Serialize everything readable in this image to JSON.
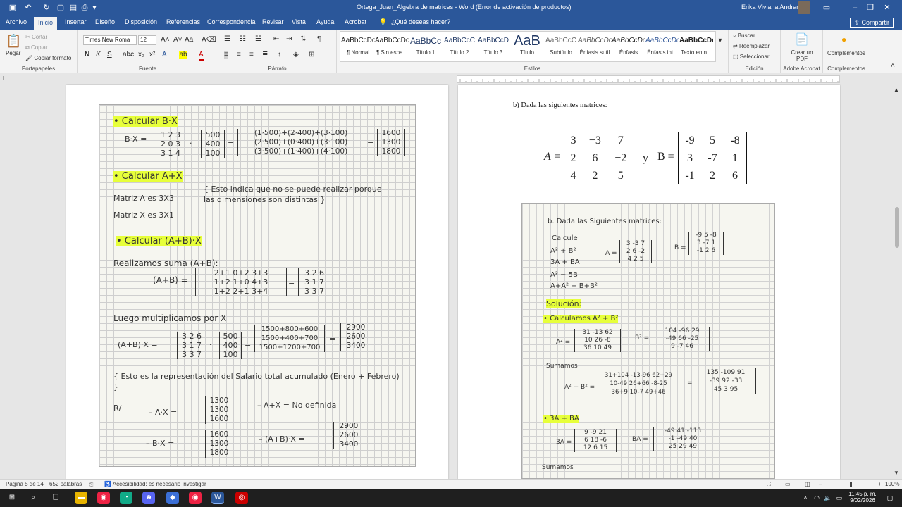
{
  "titlebar": {
    "document_title": "Ortega_Juan_Algebra de matrices  -  Word (Error de activación de productos)",
    "user": "Erika Viviana Andrade"
  },
  "menu": {
    "tabs": [
      "Archivo",
      "Inicio",
      "Insertar",
      "Diseño",
      "Disposición",
      "Referencias",
      "Correspondencia",
      "Revisar",
      "Vista",
      "Ayuda",
      "Acrobat"
    ],
    "search": "¿Qué deseas hacer?",
    "share": "Compartir"
  },
  "ribbon": {
    "clipboard": {
      "paste": "Pegar",
      "cut": "Cortar",
      "copy": "Copiar",
      "format_painter": "Copiar formato",
      "label": "Portapapeles"
    },
    "font": {
      "family": "Times New Roma",
      "size": "12",
      "label": "Fuente",
      "bold": "N",
      "italic": "K",
      "underline": "S"
    },
    "paragraph": {
      "label": "Párrafo"
    },
    "styles": {
      "label": "Estilos",
      "items": [
        {
          "preview": "AaBbCcDc",
          "name": "¶ Normal"
        },
        {
          "preview": "AaBbCcDc",
          "name": "¶ Sin espa..."
        },
        {
          "preview": "AaBbCc",
          "name": "Título 1"
        },
        {
          "preview": "AaBbCcC",
          "name": "Título 2"
        },
        {
          "preview": "AaBbCcD",
          "name": "Título 3"
        },
        {
          "preview": "AaB",
          "name": "Título"
        },
        {
          "preview": "AaBbCcC",
          "name": "Subtítulo"
        },
        {
          "preview": "AaBbCcDc",
          "name": "Énfasis sutil"
        },
        {
          "preview": "AaBbCcDc",
          "name": "Énfasis"
        },
        {
          "preview": "AaBbCcDc",
          "name": "Énfasis int..."
        },
        {
          "preview": "AaBbCcDc",
          "name": "Texto en n..."
        }
      ]
    },
    "editing": {
      "find": "Buscar",
      "replace": "Reemplazar",
      "select": "Seleccionar",
      "label": "Edición"
    },
    "adobe": {
      "create_pdf": "Crear un PDF",
      "label": "Adobe Acrobat"
    },
    "addins": {
      "button": "Complementos",
      "label": "Complementos"
    }
  },
  "document": {
    "heading": "b)   Dada las siguientes matrices:",
    "matrix_A": [
      [
        "3",
        "−3",
        "7"
      ],
      [
        "2",
        "6",
        "−2"
      ],
      [
        "4",
        "2",
        "5"
      ]
    ],
    "matrix_B": [
      [
        "-9",
        "5",
        "-8"
      ],
      [
        "3",
        "-7",
        "1"
      ],
      [
        "-1",
        "2",
        "6"
      ]
    ],
    "A_label": "A =",
    "conj": "y",
    "B_label": "B =",
    "notes1": [
      "• Calcular B·X",
      "B·X = [1 2 3 / 2 0 3 / 3 1 4] · [500 / 400 / 100] = [(1·500)+(2·400)+(3·100) / (2·500)+(0·400)+(3·100) / (3·500)+(1·400)+(4·100)] = [1600 / 1300 / 1800]",
      "• Calcular A+X",
      "Matriz A es 3X3",
      "{ Esto indica que no se puede realizar porque las dimensiones son distintas }",
      "Matriz X es 3X1",
      "• Calcular (A+B)·X",
      "Realizamos suma (A+B):",
      "(A+B) = [2+1 0+2 3+3 / 1+2 1+0 4+3 / 1+2 2+1 3+4] = [3 2 6 / 3 1 7 / 3 3 7]",
      "Luego multiplicamos por X",
      "(A+B)·X = [3 2 6 / 3 1 7 / 3 3 7] · [500 / 400 / 100] = [1500+800+600 / 1500+400+700 / 1500+1200+700] = [2900 / 2600 / 3400]",
      "{ Esto es la representación del Salario total acumulado (Enero + Febrero) }",
      "R/ –  A·X = [1300 / 1300 / 1600]   – A+X = No definida",
      "– B·X = [1600 / 1300 / 1800]   – (A+B)·X = [2900 / 2600 / 3400]"
    ],
    "notes2": [
      "b. Dada las Siguientes matrices:",
      "Calcule",
      "A² + B²",
      "3A + BA",
      "A² − 5B",
      "A+A² + B+B²",
      "Solución:",
      "• Calculamos A² + B²",
      "A² = [31 -13 62 / 10 26 -8 / 36 10 49]   B² = [104 -96 29 / -49 66 -25 / 9 -7 46]",
      "Sumamos",
      "A² + B² = [31+104 -13-96 62+29 / 10-49 26+66 -8-25 / 36+9 10-7 49+46] = [135 -109 91 / -39 92 -33 / 45 3 95]",
      "• 3A + BA",
      "3A = [9 -9 21 / 6 18 -6 / 12 6 15]   BA = [-49 41 -113 / -1 -49 40 / 25 29 49]",
      "Sumamos"
    ]
  },
  "status": {
    "page": "Página 5 de 14",
    "words": "652 palabras",
    "accessibility": "Accesibilidad: es necesario investigar",
    "zoom": "100%"
  },
  "taskbar": {
    "time": "11:45 p. m.",
    "date": "9/02/2026"
  }
}
